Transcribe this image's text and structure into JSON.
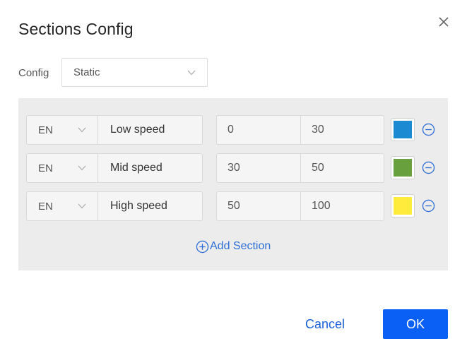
{
  "dialog": {
    "title": "Sections Config",
    "config_label": "Config",
    "config_value": "Static"
  },
  "sections": [
    {
      "lang": "EN",
      "name": "Low speed",
      "min": "0",
      "max": "30",
      "color": "#1b8ad3"
    },
    {
      "lang": "EN",
      "name": "Mid speed",
      "min": "30",
      "max": "50",
      "color": "#67a03d"
    },
    {
      "lang": "EN",
      "name": "High speed",
      "min": "50",
      "max": "100",
      "color": "#ffeb3b"
    }
  ],
  "actions": {
    "add_section": "Add Section",
    "cancel": "Cancel",
    "ok": "OK"
  },
  "colors": {
    "accent": "#0a60f5",
    "panel_bg": "#ececec"
  }
}
